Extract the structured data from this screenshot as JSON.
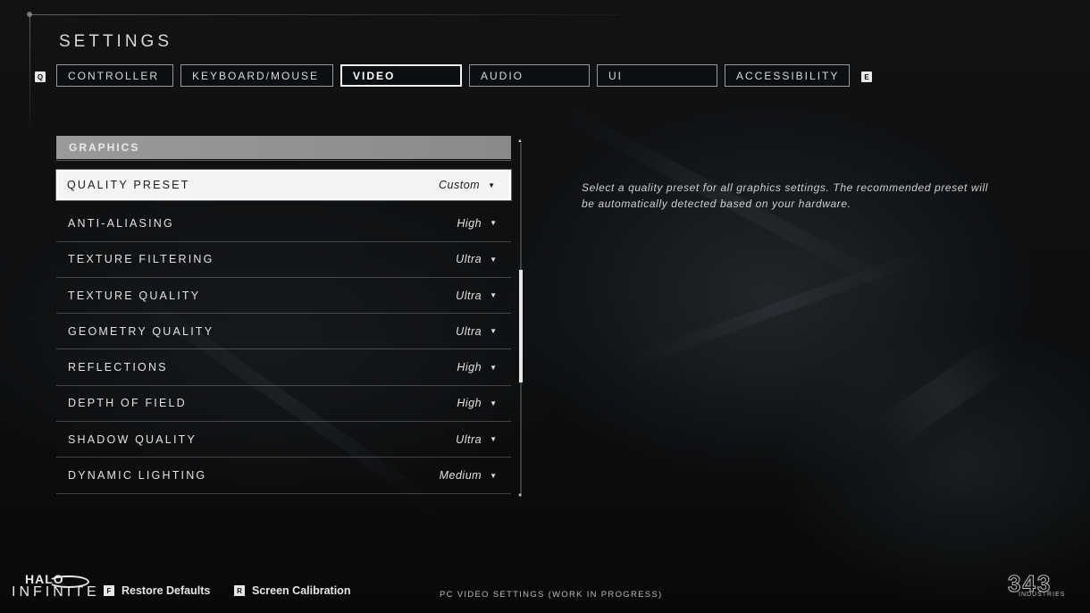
{
  "page": {
    "title": "SETTINGS",
    "footer_note": "PC VIDEO SETTINGS (WORK IN PROGRESS)"
  },
  "tabs": {
    "prev_key": "Q",
    "next_key": "E",
    "items": [
      {
        "label": "CONTROLLER"
      },
      {
        "label": "KEYBOARD/MOUSE"
      },
      {
        "label": "VIDEO"
      },
      {
        "label": "AUDIO"
      },
      {
        "label": "UI"
      },
      {
        "label": "ACCESSIBILITY"
      }
    ],
    "active": "VIDEO"
  },
  "graphics": {
    "header": "GRAPHICS",
    "rows": [
      {
        "label": "QUALITY PRESET",
        "value": "Custom"
      },
      {
        "label": "ANTI-ALIASING",
        "value": "High"
      },
      {
        "label": "TEXTURE FILTERING",
        "value": "Ultra"
      },
      {
        "label": "TEXTURE QUALITY",
        "value": "Ultra"
      },
      {
        "label": "GEOMETRY QUALITY",
        "value": "Ultra"
      },
      {
        "label": "REFLECTIONS",
        "value": "High"
      },
      {
        "label": "DEPTH OF FIELD",
        "value": "High"
      },
      {
        "label": "SHADOW QUALITY",
        "value": "Ultra"
      },
      {
        "label": "DYNAMIC LIGHTING",
        "value": "Medium"
      }
    ]
  },
  "description": "Select a quality preset for all graphics settings. The recommended preset will be automatically detected based on your hardware.",
  "footer": {
    "restore_key": "F",
    "restore_label": "Restore Defaults",
    "calibration_key": "R",
    "calibration_label": "Screen Calibration"
  },
  "branding": {
    "game_logo_top": "HALO",
    "game_logo_bottom": "INFINITE",
    "studio_logo": "343",
    "studio_logo_sub": "INDUSTRIES"
  },
  "icons": {
    "dropdown": "caret-down-icon",
    "scroll_up": "scroll-up-arrow-icon",
    "scroll_down": "scroll-down-arrow-icon"
  },
  "colors": {
    "background": "#0b0d0f",
    "selected_row_bg": "#f4f4f4",
    "header_bg": "#9a9a9a",
    "text": "#e6e6e6"
  }
}
